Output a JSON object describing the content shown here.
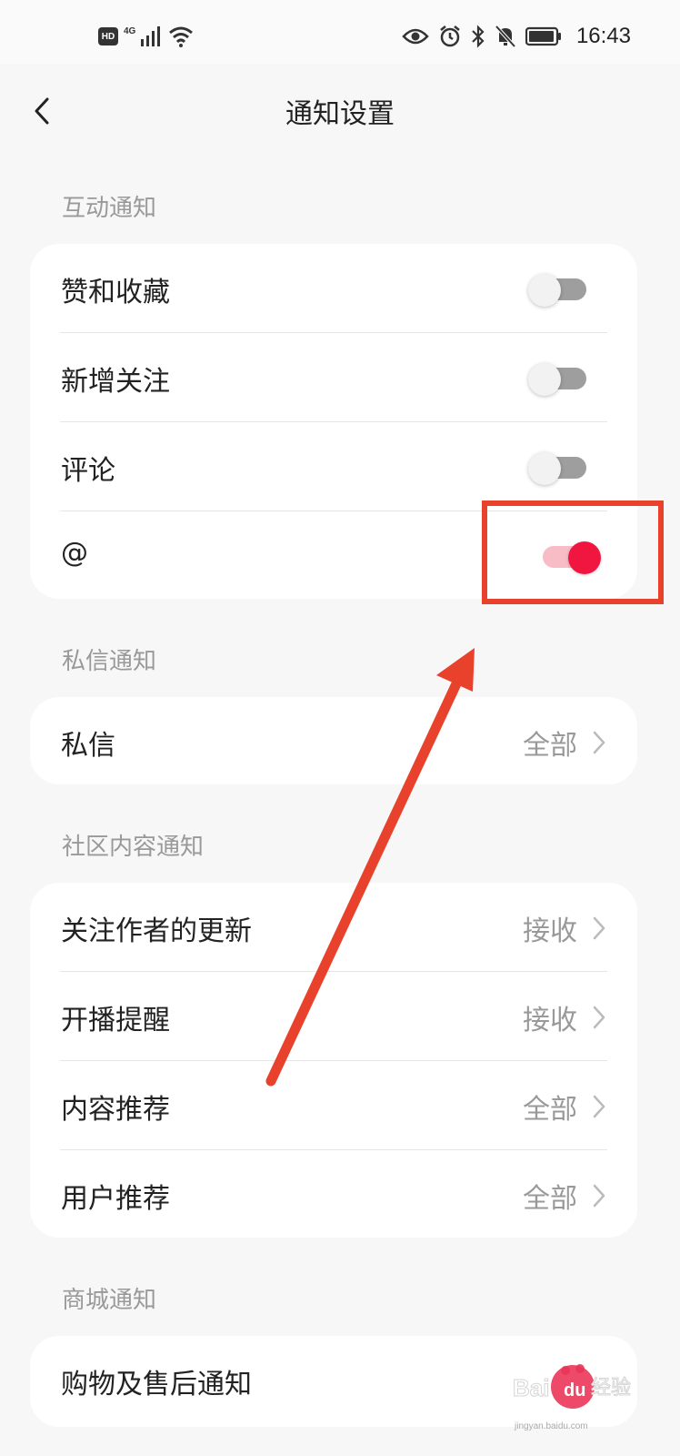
{
  "status_bar": {
    "hd": "HD",
    "network": "4G",
    "time": "16:43"
  },
  "header": {
    "title": "通知设置"
  },
  "sections": {
    "interaction": {
      "label": "互动通知",
      "rows": [
        {
          "label": "赞和收藏",
          "toggle_on": false
        },
        {
          "label": "新增关注",
          "toggle_on": false
        },
        {
          "label": "评论",
          "toggle_on": false
        },
        {
          "label": "@",
          "toggle_on": true
        }
      ]
    },
    "private_message": {
      "label": "私信通知",
      "rows": [
        {
          "label": "私信",
          "value": "全部"
        }
      ]
    },
    "community": {
      "label": "社区内容通知",
      "rows": [
        {
          "label": "关注作者的更新",
          "value": "接收"
        },
        {
          "label": "开播提醒",
          "value": "接收"
        },
        {
          "label": "内容推荐",
          "value": "全部"
        },
        {
          "label": "用户推荐",
          "value": "全部"
        }
      ]
    },
    "mall": {
      "label": "商城通知",
      "rows": [
        {
          "label": "购物及售后通知"
        }
      ]
    }
  },
  "watermark": {
    "logo_text": "Baidu经验",
    "url": "jingyan.baidu.com"
  },
  "colors": {
    "toggle_on": "#f0163f",
    "toggle_on_track": "#f7bcc6",
    "annotation": "#e8412c"
  }
}
